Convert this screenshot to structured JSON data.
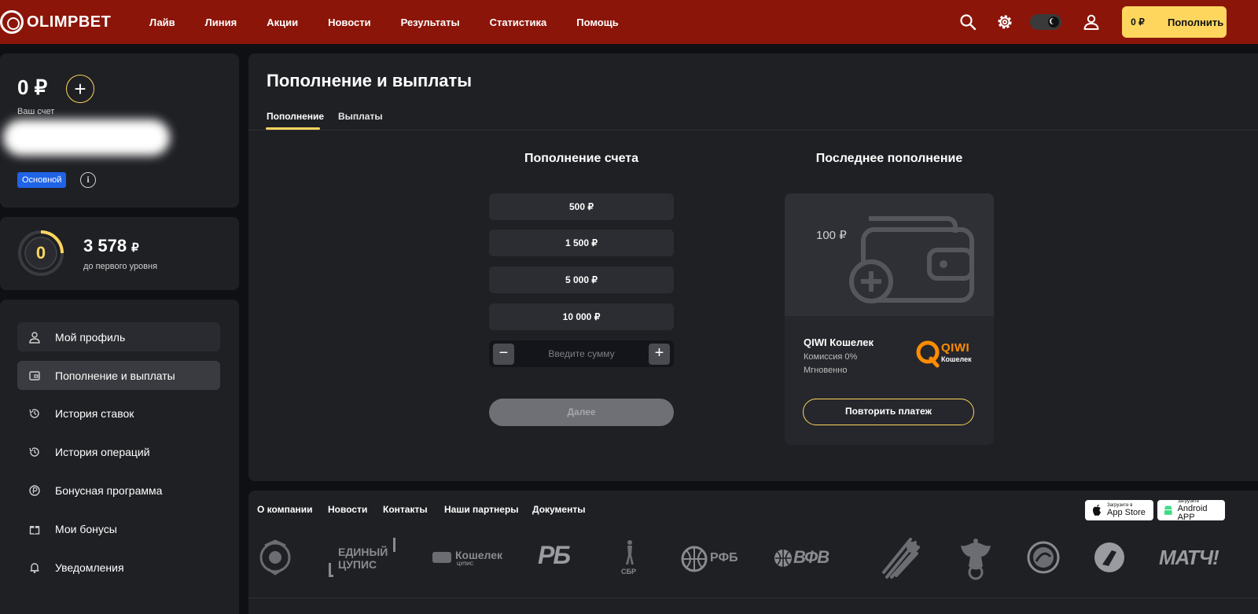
{
  "header": {
    "logo_text": "OLIMPBET",
    "nav": [
      "Лайв",
      "Линия",
      "Акции",
      "Новости",
      "Результаты",
      "Статистика",
      "Помощь"
    ],
    "deposit_balance": "0 ₽",
    "deposit_label": "Пополнить"
  },
  "account": {
    "balance": "0 ₽",
    "balance_caption": "Ваш счет",
    "badge": "Основной"
  },
  "loyalty": {
    "level": "0",
    "points": "3 578",
    "currency": "₽",
    "caption": "до первого уровня"
  },
  "sidebar": {
    "items": [
      {
        "label": "Мой профиль",
        "icon": "user-icon"
      },
      {
        "label": "Пополнение и выплаты",
        "icon": "wallet-icon"
      },
      {
        "label": "История ставок",
        "icon": "history-icon"
      },
      {
        "label": "История операций",
        "icon": "history-icon"
      },
      {
        "label": "Бонусная программа",
        "icon": "ruble-coin-icon"
      },
      {
        "label": "Мои бонусы",
        "icon": "gift-icon"
      },
      {
        "label": "Уведомления",
        "icon": "bell-icon"
      }
    ]
  },
  "main": {
    "title": "Пополнение и выплаты",
    "tabs": [
      "Пополнение",
      "Выплаты"
    ],
    "deposit_title": "Пополнение счета",
    "amounts": [
      "500 ₽",
      "1 500 ₽",
      "5 000 ₽",
      "10 000 ₽"
    ],
    "amount_minus": "−",
    "amount_plus": "+",
    "amount_placeholder": "Введите сумму",
    "next_label": "Далее",
    "last_title": "Последнее пополнение",
    "last_amount": "100 ₽",
    "method_name": "QIWI Кошелек",
    "method_fee": "Комиссия 0%",
    "method_speed": "Мгновенно",
    "qiwi_logo_top": "QIWI",
    "qiwi_logo_bottom": "Кошелек",
    "repeat_label": "Повторить платеж"
  },
  "footer": {
    "links": [
      "О компании",
      "Новости",
      "Контакты",
      "Наши партнеры",
      "Документы"
    ],
    "appstore_small": "Загрузите в",
    "appstore_big": "App Store",
    "android_small": "Загрузите",
    "android_big": "Android APP",
    "partners": {
      "cupis_1": "ЕДИНЫЙ",
      "cupis_2": "ЦУПИС",
      "wallet_1": "Кошелек",
      "wallet_2": "ЦУПИС",
      "rb": "РБ",
      "sbr": "СБР",
      "rfb": "РФБ",
      "vfv": "ВФВ",
      "match": "МАТЧ!"
    }
  }
}
